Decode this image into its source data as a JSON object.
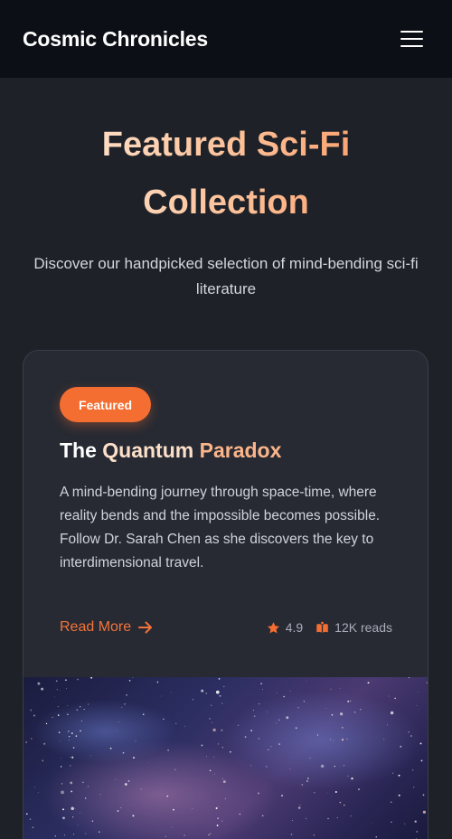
{
  "header": {
    "brand": "Cosmic Chronicles",
    "menu_icon": "hamburger-menu-icon"
  },
  "hero": {
    "title": "Featured Sci-Fi Collection",
    "subtitle": "Discover our handpicked selection of mind-bending sci-fi literature"
  },
  "card": {
    "badge": "Featured",
    "title_words": [
      "The",
      "Quantum",
      "Paradox"
    ],
    "description": "A mind-bending journey through space-time, where reality bends and the impossible becomes possible. Follow Dr. Sarah Chen as she discovers the key to interdimensional travel.",
    "read_more": "Read More",
    "rating": "4.9",
    "reads": "12K reads",
    "icons": {
      "read_more": "arrow-right-icon",
      "rating": "star-icon",
      "reads": "open-book-icon"
    }
  },
  "colors": {
    "accent": "#f46d31",
    "background": "#1e2128",
    "header": "#0c0f16",
    "card": "#272a33"
  }
}
